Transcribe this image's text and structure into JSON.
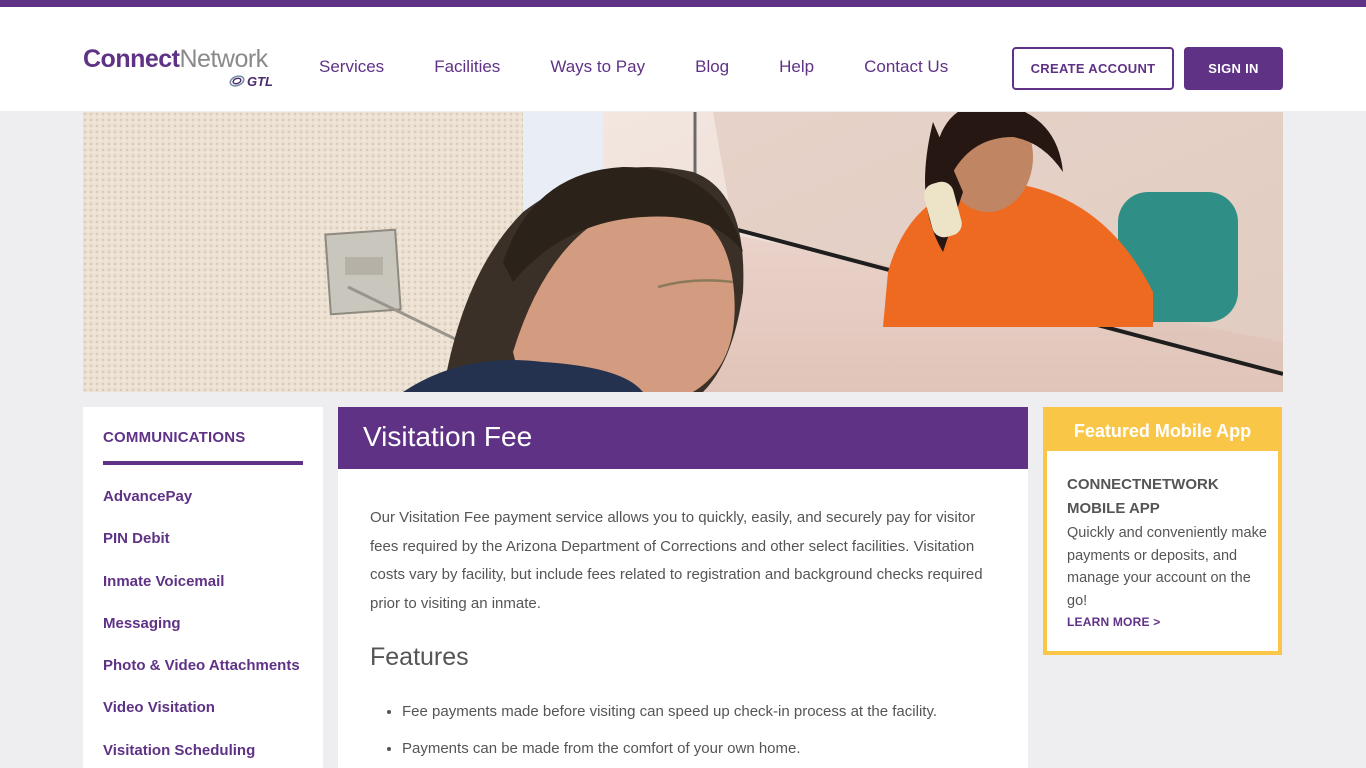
{
  "brand": {
    "logo_primary": "Connect",
    "logo_secondary": "Network",
    "logo_sub": "GTL"
  },
  "nav": {
    "items": [
      "Services",
      "Facilities",
      "Ways to Pay",
      "Blog",
      "Help",
      "Contact Us"
    ],
    "create_account": "CREATE ACCOUNT",
    "sign_in": "SIGN IN"
  },
  "colors": {
    "brand_purple": "#5f3286",
    "accent_yellow": "#f9c647",
    "page_bg": "#eeedf0"
  },
  "sidebar": {
    "heading": "COMMUNICATIONS",
    "items": [
      "AdvancePay",
      "PIN Debit",
      "Inmate Voicemail",
      "Messaging",
      "Photo & Video Attachments",
      "Video Visitation",
      "Visitation Scheduling"
    ]
  },
  "main": {
    "title": "Visitation Fee",
    "intro": "Our Visitation Fee payment service allows you to quickly, easily, and securely pay for visitor fees required by the Arizona Department of Corrections and other select facilities. Visitation costs vary by facility, but include fees related to registration and background checks required prior to visiting an inmate.",
    "features_heading": "Features",
    "features": [
      "Fee payments made before visiting can speed up check-in process at the facility.",
      "Payments can be made from the comfort of your own home."
    ]
  },
  "featured": {
    "heading": "Featured Mobile App",
    "title": "CONNECTNETWORK MOBILE APP",
    "description": "Quickly and conveniently make payments or deposits, and manage your account on the go!",
    "link": "LEARN MORE >"
  }
}
